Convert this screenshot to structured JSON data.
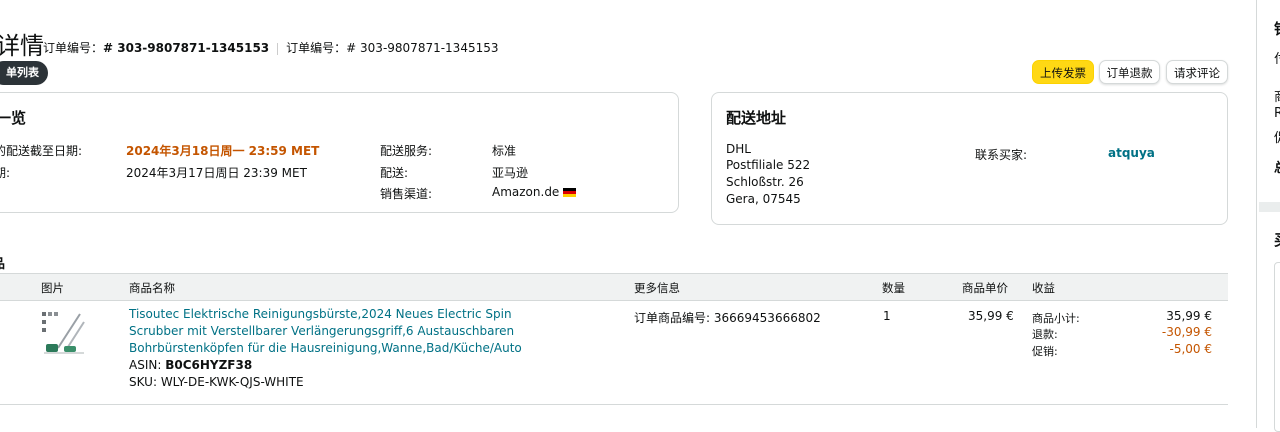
{
  "header": {
    "title_fragment": "详情",
    "order_label_1": "订单编号：",
    "order_number_1": "# 303-9807871-1345153",
    "order_label_2": "订单编号：",
    "order_number_2": "# 303-9807871-1345153",
    "back_pill": "单列表"
  },
  "actions": {
    "upload_invoice": "上传发票",
    "refund": "订单退款",
    "request_review": "请求评论"
  },
  "overview": {
    "title_fragment": "一览",
    "ship_by_label": "的配送截至日期:",
    "ship_by_value": "2024年3月18日周一 23:59 MET",
    "date_label": "期:",
    "date_value": "2024年3月17日周日 23:39 MET",
    "shipping_service_label": "配送服务:",
    "shipping_service_value": "标准",
    "fulfillment_label": "配送:",
    "fulfillment_value": "亚马逊",
    "channel_label": "销售渠道:",
    "channel_value": "Amazon.de"
  },
  "address": {
    "title": "配送地址",
    "lines": [
      "DHL",
      "Postfiliale 522",
      "Schloßstr. 26",
      "Gera, 07545"
    ],
    "contact_label": "联系买家:",
    "buyer_name": "atquya"
  },
  "items_section": {
    "title_fragment": "品",
    "columns": {
      "image": "图片",
      "name": "商品名称",
      "more_info": "更多信息",
      "qty": "数量",
      "unit_price": "商品单价",
      "revenue": "收益"
    },
    "rows": [
      {
        "name": "Tisoutec Elektrische Reinigungsbürste,2024 Neues Electric Spin Scrubber mit Verstellbarer Verlängerungsgriff,6 Austauschbaren Bohrbürstenköpfen für die Hausreinigung,Wanne,Bad/Küche/Auto",
        "asin_label": "ASIN: ",
        "asin": "B0C6HYZF38",
        "sku_label": "SKU: ",
        "sku": "WLY-DE-KWK-QJS-WHITE",
        "order_item_label": "订单商品编号: ",
        "order_item_id": "36669453666802",
        "qty": "1",
        "unit_price": "35,99 €",
        "subtotal_label": "商品小计:",
        "subtotal": "35,99 €",
        "refund_label": "退款:",
        "refund": "-30,99 €",
        "promo_label": "促销:",
        "promo": "-5,00 €"
      }
    ]
  },
  "right_panel": {
    "glyphs": [
      "销",
      "付",
      "商",
      "R",
      "促",
      "总",
      "买"
    ]
  },
  "colors": {
    "accent_yellow": "#ffd814",
    "link": "#007185",
    "orange": "#c45500",
    "pill_dark": "#2c3338"
  }
}
